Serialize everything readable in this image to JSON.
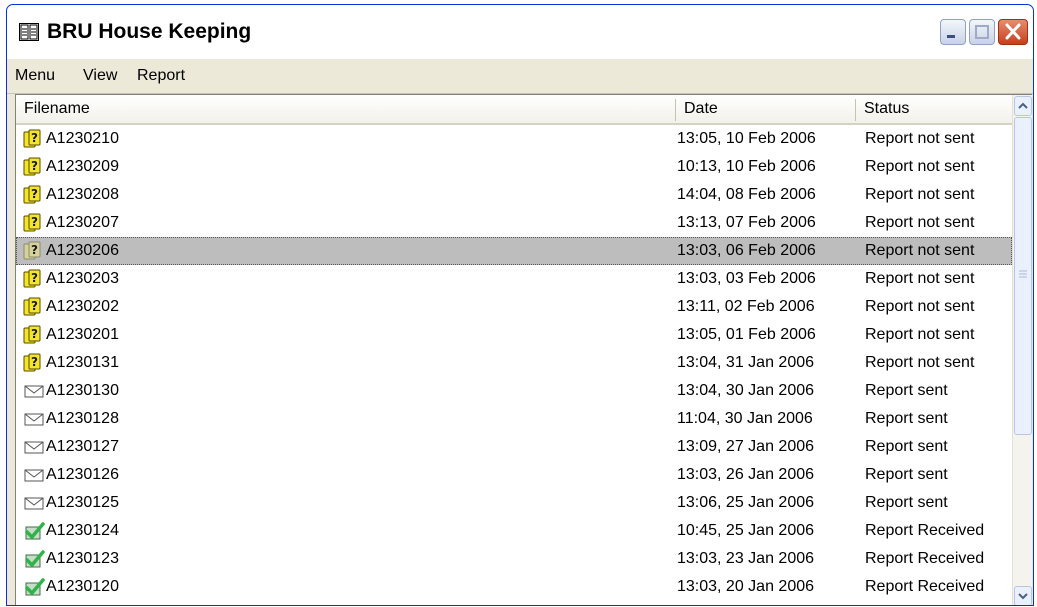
{
  "window": {
    "title": "BRU House Keeping"
  },
  "menu": {
    "items": [
      "Menu",
      "View",
      "Report"
    ]
  },
  "columns": {
    "filename": "Filename",
    "date": "Date",
    "status": "Status"
  },
  "rows": [
    {
      "filename": "A1230210",
      "date": "13:05, 10 Feb 2006",
      "status": "Report not sent",
      "icon": "question-icon"
    },
    {
      "filename": "A1230209",
      "date": "10:13, 10 Feb 2006",
      "status": "Report not sent",
      "icon": "question-icon"
    },
    {
      "filename": "A1230208",
      "date": "14:04, 08 Feb 2006",
      "status": "Report not sent",
      "icon": "question-icon"
    },
    {
      "filename": "A1230207",
      "date": "13:13, 07 Feb 2006",
      "status": "Report not sent",
      "icon": "question-icon"
    },
    {
      "filename": "A1230206",
      "date": "13:03, 06 Feb 2006",
      "status": "Report not sent",
      "icon": "question-icon",
      "selected": true
    },
    {
      "filename": "A1230203",
      "date": "13:03, 03 Feb 2006",
      "status": "Report not sent",
      "icon": "question-icon"
    },
    {
      "filename": "A1230202",
      "date": "13:11, 02 Feb 2006",
      "status": "Report not sent",
      "icon": "question-icon"
    },
    {
      "filename": "A1230201",
      "date": "13:05, 01 Feb 2006",
      "status": "Report not sent",
      "icon": "question-icon"
    },
    {
      "filename": "A1230131",
      "date": "13:04, 31 Jan 2006",
      "status": "Report not sent",
      "icon": "question-icon"
    },
    {
      "filename": "A1230130",
      "date": "13:04, 30 Jan 2006",
      "status": "Report sent",
      "icon": "envelope-icon"
    },
    {
      "filename": "A1230128",
      "date": "11:04, 30 Jan 2006",
      "status": "Report sent",
      "icon": "envelope-icon"
    },
    {
      "filename": "A1230127",
      "date": "13:09, 27 Jan 2006",
      "status": "Report sent",
      "icon": "envelope-icon"
    },
    {
      "filename": "A1230126",
      "date": "13:03, 26 Jan 2006",
      "status": "Report sent",
      "icon": "envelope-icon"
    },
    {
      "filename": "A1230125",
      "date": "13:06, 25 Jan 2006",
      "status": "Report sent",
      "icon": "envelope-icon"
    },
    {
      "filename": "A1230124",
      "date": "10:45, 25 Jan 2006",
      "status": "Report Received",
      "icon": "check-icon"
    },
    {
      "filename": "A1230123",
      "date": "13:03, 23 Jan 2006",
      "status": "Report Received",
      "icon": "check-icon"
    },
    {
      "filename": "A1230120",
      "date": "13:03, 20 Jan 2006",
      "status": "Report Received",
      "icon": "check-icon"
    }
  ],
  "colors": {
    "selection": "#bdbdbd",
    "close_button": "#d65a35",
    "question_icon": "#f2e52a",
    "check_icon": "#2fb34a"
  }
}
